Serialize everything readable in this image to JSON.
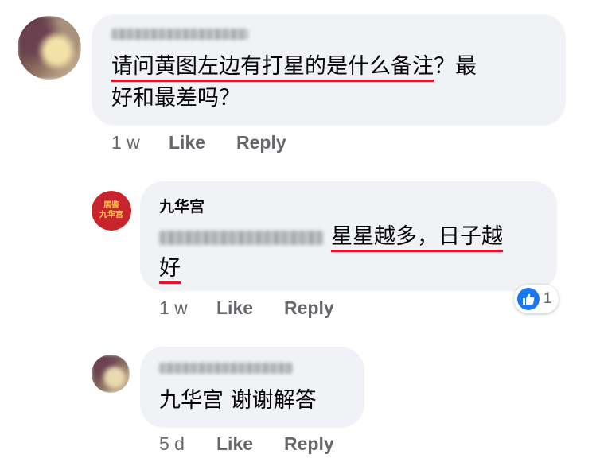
{
  "comments": [
    {
      "author": "Michelle Khor",
      "text_main": "请问黄图左边有打星的是什么备注",
      "text_rest": "？最",
      "text_line2": "好和最差吗？",
      "time": "1 w",
      "like_label": "Like",
      "reply_label": "Reply"
    },
    {
      "author": "九华宫",
      "seal_top": "居鉴",
      "seal_bottom": "九华宫",
      "mention": "Michelle Khor",
      "text_line1": "星星越多，日子越",
      "text_line2": "好",
      "time": "1 w",
      "like_label": "Like",
      "reply_label": "Reply",
      "reaction_icon": "thumbs-up-icon",
      "reaction_count": "1"
    },
    {
      "author": "Michelle Khor",
      "text": "九华宫 谢谢解答",
      "time": "5 d",
      "like_label": "Like",
      "reply_label": "Reply"
    }
  ],
  "colors": {
    "bubble": "#f0f2f5",
    "meta": "#65676b",
    "underline": "#e0162b",
    "like_blue": "#1877f2",
    "seal_red": "#c8242b"
  }
}
